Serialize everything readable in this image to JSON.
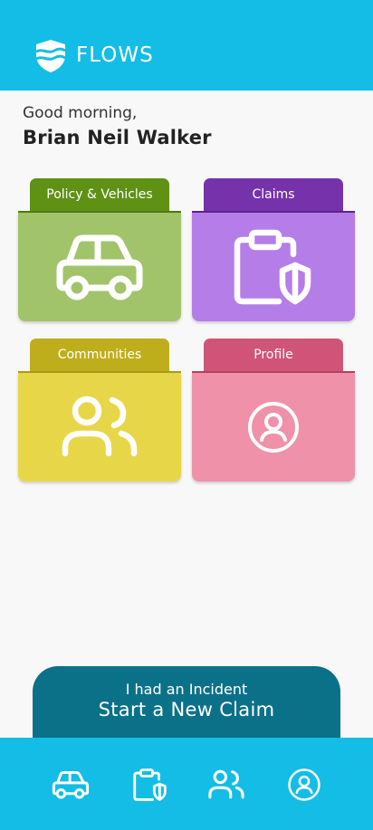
{
  "header": {
    "brand": "FLOWS",
    "logo_icon": "shield-waves-icon",
    "background": "#13bde6"
  },
  "greeting": {
    "salutation": "Good morning,",
    "name": "Brian Neil Walker"
  },
  "cards": {
    "policy": {
      "label": "Policy & Vehicles",
      "icon": "car-icon",
      "color": "#a1c46a"
    },
    "claims": {
      "label": "Claims",
      "icon": "clipboard-shield-icon",
      "color": "#b57de8"
    },
    "communities": {
      "label": "Communities",
      "icon": "users-icon",
      "color": "#e8d649"
    },
    "profile": {
      "label": "Profile",
      "icon": "user-circle-icon",
      "color": "#ef91a8"
    }
  },
  "cta": {
    "subtitle": "I had an Incident",
    "title": "Start a New Claim",
    "color": "#0b7189"
  },
  "bottom_nav": {
    "items": [
      {
        "icon": "car-icon"
      },
      {
        "icon": "clipboard-shield-icon"
      },
      {
        "icon": "users-icon"
      },
      {
        "icon": "user-circle-icon"
      }
    ]
  }
}
